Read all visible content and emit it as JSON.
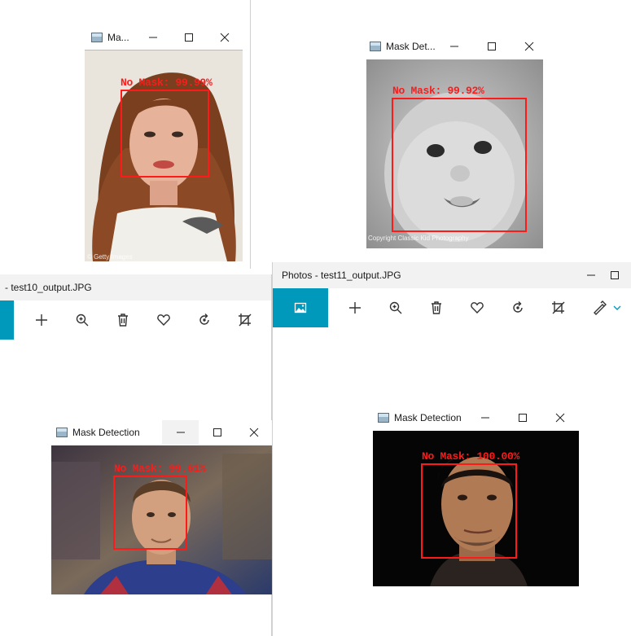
{
  "colors": {
    "accent": "#0099bc",
    "detection": "#ff1a1a",
    "photos_title_bg": "#f2f2f2"
  },
  "window_a": {
    "title": "Ma...",
    "detection_label": "No Mask: 99.99%",
    "watermark": "© Getty Images",
    "buttons": [
      "minimize-icon",
      "maximize-icon",
      "close-icon"
    ]
  },
  "window_b": {
    "title": "Mask Det...",
    "detection_label": "No Mask: 99.92%",
    "watermark": "Copyright Classic Kid Photography",
    "buttons": [
      "minimize-icon",
      "maximize-icon",
      "close-icon"
    ]
  },
  "photos_left": {
    "title": "- test10_output.JPG",
    "toolbar_icons": [
      "add-icon",
      "zoom-icon",
      "delete-icon",
      "favorite-icon",
      "rotate-icon",
      "crop-icon"
    ]
  },
  "window_c": {
    "title": "Mask Detection",
    "detection_label": "No Mask: 99.61%",
    "buttons": [
      "minimize-icon",
      "maximize-icon",
      "close-icon"
    ]
  },
  "photos_right": {
    "title": "Photos - test11_output.JPG",
    "toolbar_icons": [
      "image-icon",
      "add-icon",
      "zoom-icon",
      "delete-icon",
      "favorite-icon",
      "rotate-icon",
      "crop-icon",
      "edit-icon",
      "chevron-down-icon"
    ]
  },
  "window_d": {
    "title": "Mask Detection",
    "detection_label": "No Mask: 100.00%",
    "buttons": [
      "minimize-icon",
      "maximize-icon",
      "close-icon"
    ]
  }
}
